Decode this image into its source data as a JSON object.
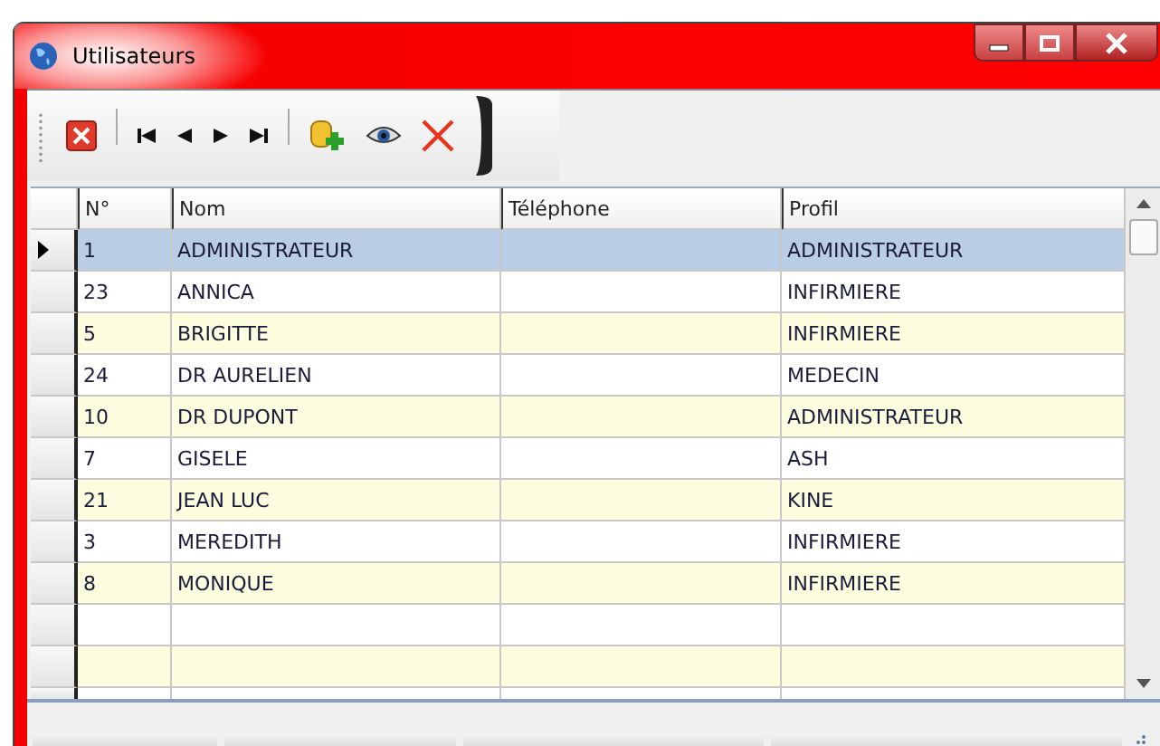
{
  "window": {
    "title": "Utilisateurs"
  },
  "table": {
    "columns": [
      "N°",
      "Nom",
      "Téléphone",
      "Profil"
    ],
    "rows": [
      {
        "cells": [
          "1",
          "ADMINISTRATEUR",
          "",
          "ADMINISTRATEUR"
        ],
        "selected": true
      },
      {
        "cells": [
          "23",
          "ANNICA",
          "",
          "INFIRMIERE"
        ],
        "selected": false
      },
      {
        "cells": [
          "5",
          "BRIGITTE",
          "",
          "INFIRMIERE"
        ],
        "selected": false
      },
      {
        "cells": [
          "24",
          "DR AURELIEN",
          "",
          "MEDECIN"
        ],
        "selected": false
      },
      {
        "cells": [
          "10",
          "DR DUPONT",
          "",
          "ADMINISTRATEUR"
        ],
        "selected": false
      },
      {
        "cells": [
          "7",
          "GISELE",
          "",
          "ASH"
        ],
        "selected": false
      },
      {
        "cells": [
          "21",
          "JEAN LUC",
          "",
          "KINE"
        ],
        "selected": false
      },
      {
        "cells": [
          "3",
          "MEREDITH",
          "",
          "INFIRMIERE"
        ],
        "selected": false
      },
      {
        "cells": [
          "8",
          "MONIQUE",
          "",
          "INFIRMIERE"
        ],
        "selected": false
      }
    ]
  }
}
